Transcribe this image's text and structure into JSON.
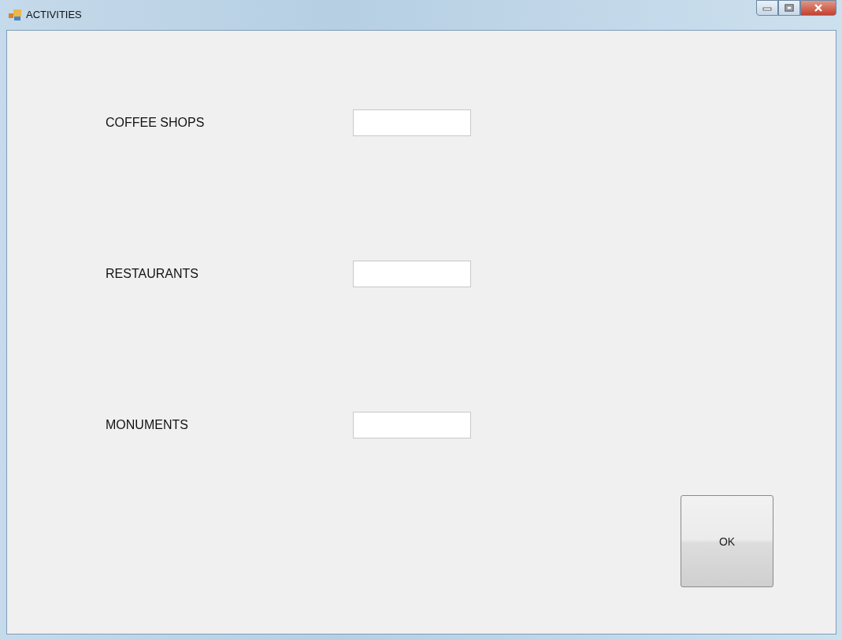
{
  "window": {
    "title": "ACTIVITIES"
  },
  "fields": [
    {
      "label": "COFFEE SHOPS"
    },
    {
      "label": "RESTAURANTS"
    },
    {
      "label": "MONUMENTS"
    }
  ],
  "buttons": [
    "OK"
  ]
}
